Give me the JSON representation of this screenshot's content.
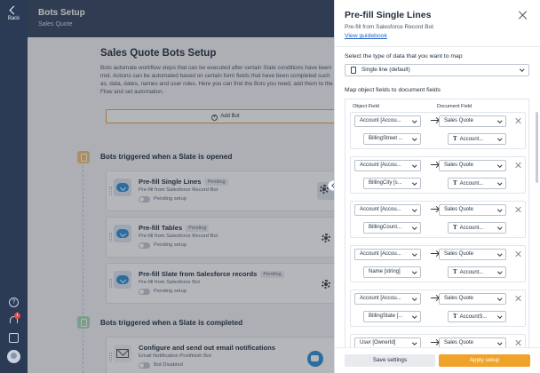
{
  "rail": {
    "back_label": "Back",
    "notification_count": "1",
    "icons": [
      "back-icon",
      "help-icon",
      "bell-icon",
      "calendar-icon",
      "avatar"
    ]
  },
  "header": {
    "title": "Bots Setup",
    "subtitle": "Sales Quote"
  },
  "main": {
    "setup_title": "Sales Quote Bots Setup",
    "description": "Bots automate workflow steps that can be executed after certain Slate conditions have been met. Actions can be automated based on certain form fields that have been completed such as, data, dates, names and user roles. Here you can find the Bots you need, add them to the Flow and set automation.",
    "add_bot_label": "Add Bot",
    "section_opened": {
      "title": "Bots triggered when a Slate is opened",
      "bots": [
        {
          "name": "Pre-fill Single Lines",
          "badge": "Pending",
          "source": "Pre-fill from Salesforce Record Bot",
          "status": "Pending setup"
        },
        {
          "name": "Pre-fill Tables",
          "badge": "Pending",
          "source": "Pre-fill from Salesforce Record Bot",
          "status": "Pending setup"
        },
        {
          "name": "Pre-fill Slate from Salesforce records",
          "badge": "Pending",
          "source": "Pre-fill from Salesforce Bot",
          "status": "Pending setup"
        }
      ]
    },
    "section_completed": {
      "title": "Bots triggered when a Slate is completed",
      "bots": [
        {
          "name": "Configure and send out email notifications",
          "source": "Email Notification Postfinish Bot",
          "status": "Bot Disabled"
        }
      ]
    }
  },
  "panel": {
    "title": "Pre-fill Single Lines",
    "subtitle": "Pre-fill from Salesforce Record Bot",
    "guidebook_link": "View guidebook",
    "type_label": "Select the type of data that you want to map",
    "type_value": "Single line (default)",
    "map_label": "Map object fields to document fields",
    "object_field_header": "Object Field",
    "document_field_header": "Document Field",
    "rows": [
      {
        "object": "Account [Accou...",
        "field": "BillingStreet ...",
        "doc_object": "Sales Quote",
        "doc_field": "Account..."
      },
      {
        "object": "Account [Accou...",
        "field": "BillingCity [s...",
        "doc_object": "Sales Quote",
        "doc_field": "Account..."
      },
      {
        "object": "Account [Accou...",
        "field": "BillingCount...",
        "doc_object": "Sales Quote",
        "doc_field": "Account..."
      },
      {
        "object": "Account [Accou...",
        "field": "Name [string]",
        "doc_object": "Sales Quote",
        "doc_field": "Account..."
      },
      {
        "object": "Account [Accou...",
        "field": "BillingState [...",
        "doc_object": "Sales Quote",
        "doc_field": "AccountS..."
      },
      {
        "object": "User [OwnerId]",
        "field": "",
        "doc_object": "Sales Quote",
        "doc_field": ""
      }
    ],
    "save_label": "Save settings",
    "apply_label": "Apply setup",
    "accent": "#f0a32b"
  }
}
